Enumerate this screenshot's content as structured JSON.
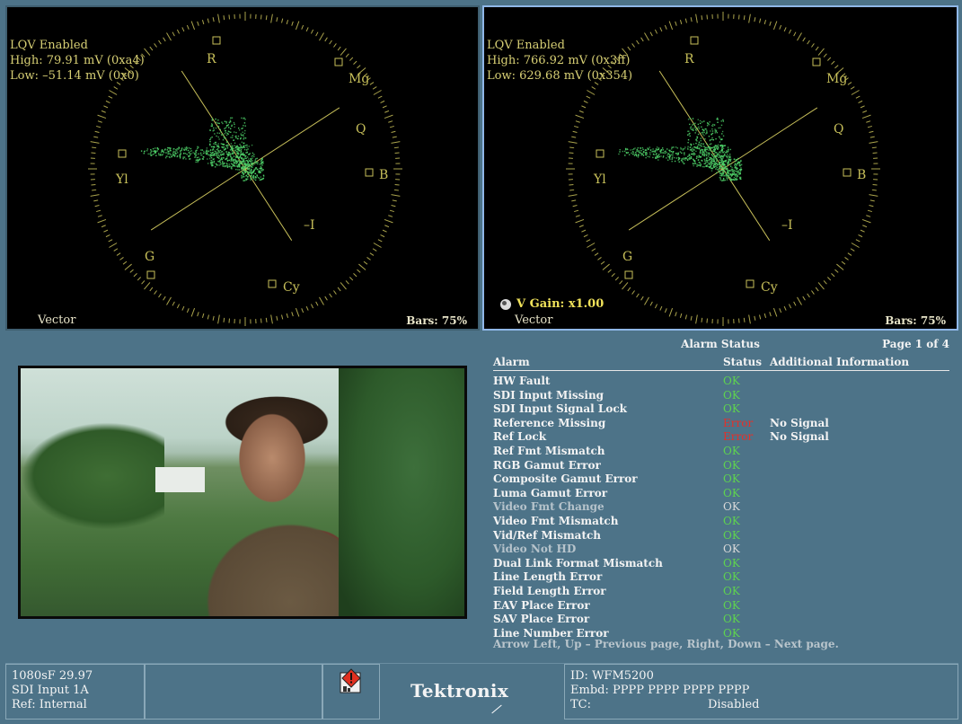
{
  "vectorscopes": [
    {
      "lqv": {
        "enabled": "LQV Enabled",
        "high": "High: 79.91 mV (0xa4)",
        "low": "Low: –51.14 mV (0x0)"
      },
      "label": "Vector",
      "bars": "Bars: 75%",
      "targets": {
        "r": "R",
        "mg": "Mg",
        "q": "Q",
        "b": "B",
        "yl": "Yl",
        "i": "–I",
        "g": "G",
        "cy": "Cy"
      }
    },
    {
      "lqv": {
        "enabled": "LQV Enabled",
        "high": "High: 766.92 mV (0x3ff)",
        "low": "Low: 629.68 mV (0x354)"
      },
      "label": "Vector",
      "bars": "Bars: 75%",
      "vgain": "V Gain: x1.00",
      "targets": {
        "r": "R",
        "mg": "Mg",
        "q": "Q",
        "b": "B",
        "yl": "Yl",
        "i": "–I",
        "g": "G",
        "cy": "Cy"
      }
    }
  ],
  "alarm_status": {
    "title": "Alarm Status",
    "page": "Page 1 of 4",
    "headers": {
      "alarm": "Alarm",
      "status": "Status",
      "info": "Additional Information"
    },
    "rows": [
      {
        "alarm": "HW Fault",
        "status": "OK",
        "state": "ok",
        "info": ""
      },
      {
        "alarm": "SDI Input Missing",
        "status": "OK",
        "state": "ok",
        "info": ""
      },
      {
        "alarm": "SDI Input Signal Lock",
        "status": "OK",
        "state": "ok",
        "info": ""
      },
      {
        "alarm": "Reference Missing",
        "status": "Error",
        "state": "error",
        "info": "No Signal"
      },
      {
        "alarm": "Ref Lock",
        "status": "Error",
        "state": "error",
        "info": "No Signal"
      },
      {
        "alarm": "Ref Fmt Mismatch",
        "status": "OK",
        "state": "ok",
        "info": ""
      },
      {
        "alarm": "RGB Gamut Error",
        "status": "OK",
        "state": "ok",
        "info": ""
      },
      {
        "alarm": "Composite Gamut Error",
        "status": "OK",
        "state": "ok",
        "info": ""
      },
      {
        "alarm": "Luma Gamut Error",
        "status": "OK",
        "state": "ok",
        "info": ""
      },
      {
        "alarm": "Video Fmt Change",
        "status": "OK",
        "state": "disabled",
        "info": ""
      },
      {
        "alarm": "Video Fmt Mismatch",
        "status": "OK",
        "state": "ok",
        "info": ""
      },
      {
        "alarm": "Vid/Ref Mismatch",
        "status": "OK",
        "state": "ok",
        "info": ""
      },
      {
        "alarm": "Video Not HD",
        "status": "OK",
        "state": "disabled",
        "info": ""
      },
      {
        "alarm": "Dual Link Format Mismatch",
        "status": "OK",
        "state": "ok",
        "info": ""
      },
      {
        "alarm": "Line Length Error",
        "status": "OK",
        "state": "ok",
        "info": ""
      },
      {
        "alarm": "Field Length Error",
        "status": "OK",
        "state": "ok",
        "info": ""
      },
      {
        "alarm": "EAV Place Error",
        "status": "OK",
        "state": "ok",
        "info": ""
      },
      {
        "alarm": "SAV Place Error",
        "status": "OK",
        "state": "ok",
        "info": ""
      },
      {
        "alarm": "Line Number Error",
        "status": "OK",
        "state": "ok",
        "info": ""
      }
    ],
    "help": "Arrow Left, Up – Previous page, Right, Down – Next page."
  },
  "status_bar": {
    "format": "1080sF 29.97",
    "input": "SDI Input 1A",
    "ref": "Ref: Internal",
    "alarm_icon": "warning-icon",
    "logo": "Tektronix",
    "id": "ID: WFM5200",
    "embd": "Embd: PPPP PPPP PPPP PPPP",
    "tc_label": "TC:",
    "tc_value": "Disabled"
  },
  "colors": {
    "ok": "#5fd34f",
    "error": "#e4302a",
    "trace": "#4fd36a",
    "graticule": "#c8c05a",
    "panel": "#4d7388"
  }
}
